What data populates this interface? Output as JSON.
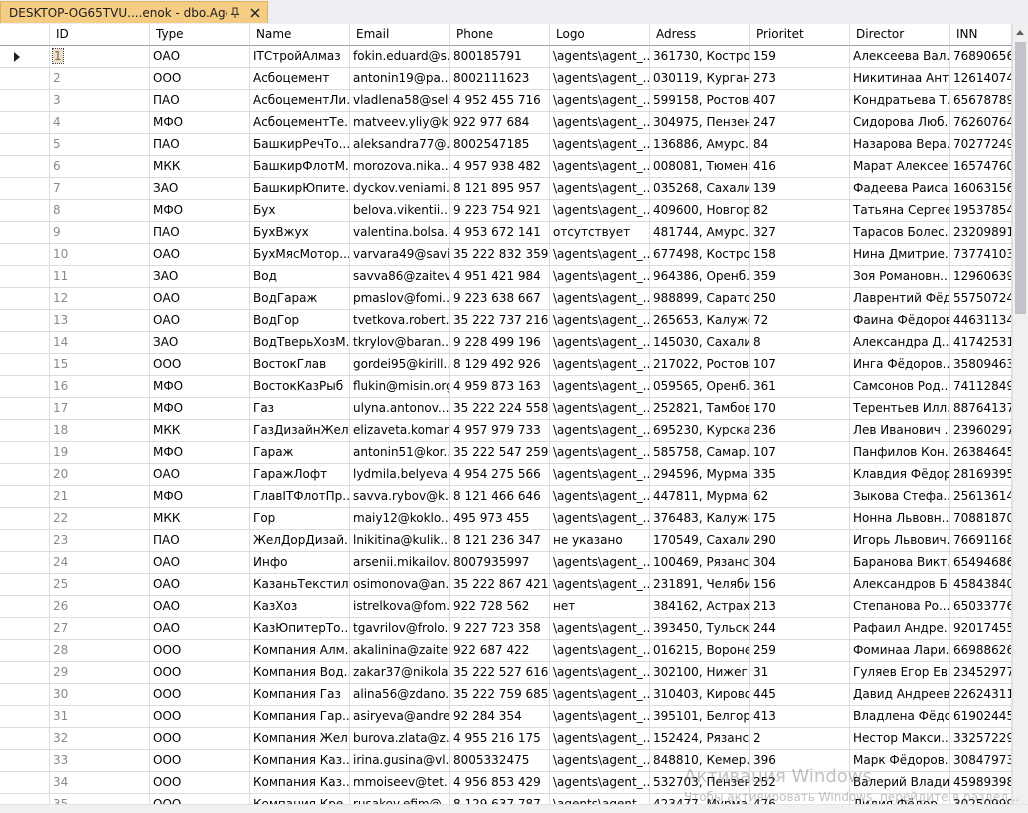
{
  "tab": {
    "title": "DESKTOP-OG65TVU....enok - dbo.Agents"
  },
  "columns": [
    "ID",
    "Type",
    "Name",
    "Email",
    "Phone",
    "Logo",
    "Adress",
    "Prioritet",
    "Director",
    "INN"
  ],
  "rows": [
    [
      "1",
      "ОАО",
      "ITСтройАлмаз",
      "fokin.eduard@s...",
      "800185791",
      "\\agents\\agent_...",
      "361730, Костро...",
      "159",
      "Алексеева Вал...",
      "7689065648"
    ],
    [
      "2",
      "ООО",
      "Асбоцемент",
      "antonin19@pa...",
      "8002111623",
      "\\agents\\agent_...",
      "030119, Курган...",
      "273",
      "Никитинаа Ант...",
      "1261407459"
    ],
    [
      "3",
      "ПАО",
      "АсбоцементЛи...",
      "vladlena58@sel...",
      "4 952 455 716",
      "\\agents\\agent_...",
      "599158, Ростов...",
      "407",
      "Кондратьева Т...",
      "6567878928"
    ],
    [
      "4",
      "МФО",
      "АсбоцементТе...",
      "matveev.yliy@k...",
      "922 977 684",
      "\\agents\\agent_...",
      "304975, Пензен...",
      "247",
      "Сидорова Люб...",
      "7626076463"
    ],
    [
      "5",
      "ПАО",
      "БашкирРечТо...",
      "aleksandra77@...",
      "8002547185",
      "\\agents\\agent_...",
      "136886, Амурс...",
      "84",
      "Назарова Вера...",
      "7027724917"
    ],
    [
      "6",
      "МКК",
      "БашкирФлотМ...",
      "morozova.nika...",
      "4 957 938 482",
      "\\agents\\agent_...",
      "008081, Тюмен...",
      "416",
      "Марат Алексее...",
      "1657476072"
    ],
    [
      "7",
      "ЗАО",
      "БашкирЮпите...",
      "dyckov.veniami...",
      "8 121 895 957",
      "\\agents\\agent_...",
      "035268, Сахали...",
      "139",
      "Фадеева Раиса ...",
      "1606315697"
    ],
    [
      "8",
      "МФО",
      "Бух",
      "belova.vikentii...",
      "9 223 754 921",
      "\\agents\\agent_...",
      "409600, Новгор...",
      "82",
      "Татьяна Сергее...",
      "1953785418"
    ],
    [
      "9",
      "ПАО",
      "БухВжух",
      "valentina.bolsa...",
      "4 953 672 141",
      "отсутствует",
      "481744, Амурс...",
      "327",
      "Тарасов Болес...",
      "2320989197"
    ],
    [
      "10",
      "ОАО",
      "БухМясМотор...",
      "varvara49@savi...",
      "35 222 832 359",
      "\\agents\\agent_...",
      "677498, Костро...",
      "158",
      "Нина Дмитрие...",
      "7377410338"
    ],
    [
      "11",
      "ЗАО",
      "Вод",
      "savva86@zaitev...",
      "4 951 421 984",
      "\\agents\\agent_...",
      "964386, Оренб...",
      "359",
      "Зоя Романовн...",
      "1296063939"
    ],
    [
      "12",
      "ОАО",
      "ВодГараж",
      "pmaslov@fomi...",
      "9 223 638 667",
      "\\agents\\agent_...",
      "988899, Сарато...",
      "250",
      "Лаврентий Фёд...",
      "5575072431"
    ],
    [
      "13",
      "ОАО",
      "ВодГор",
      "tvetkova.robert...",
      "35 222 737 216",
      "\\agents\\agent_...",
      "265653, Калужс...",
      "72",
      "Фаина Фёдоров...",
      "4463113470"
    ],
    [
      "14",
      "ЗАО",
      "ВодТверьХозМ...",
      "tkrylov@baran...",
      "9 228 499 196",
      "\\agents\\agent_...",
      "145030, Сахали...",
      "8",
      "Александра Д...",
      "4174253174"
    ],
    [
      "15",
      "ООО",
      "ВостокГлав",
      "gordei95@kirill...",
      "8 129 492 926",
      "\\agents\\agent_...",
      "217022, Ростов...",
      "107",
      "Инга Фёдоров...",
      "3580946305"
    ],
    [
      "16",
      "МФО",
      "ВостокКазРыб",
      "flukin@misin.org",
      "4 959 873 163",
      "\\agents\\agent_...",
      "059565, Оренб...",
      "361",
      "Самсонов Род...",
      "7411284960"
    ],
    [
      "17",
      "МФО",
      "Газ",
      "ulyna.antonov...",
      "35 222 224 558",
      "\\agents\\agent_...",
      "252821, Тамбов...",
      "170",
      "Терентьев Илл...",
      "8876413796"
    ],
    [
      "18",
      "МКК",
      "ГазДизайнЖел...",
      "elizaveta.komar...",
      "4 957 979 733",
      "\\agents\\agent_...",
      "695230, Курска...",
      "236",
      "Лев Иванович ...",
      "2396029740"
    ],
    [
      "19",
      "МФО",
      "Гараж",
      "antonin51@kor...",
      "35 222 547 259",
      "\\agents\\agent_...",
      "585758, Самар...",
      "107",
      "Панфилов Кон...",
      "2638464552"
    ],
    [
      "20",
      "ОАО",
      "ГаражЛофт",
      "lydmila.belyeva...",
      "4 954 275 566",
      "\\agents\\agent_...",
      "294596, Мурма...",
      "335",
      "Клавдия Фёдор...",
      "2816939574"
    ],
    [
      "21",
      "МФО",
      "ГлавITФлотПр...",
      "savva.rybov@k...",
      "8 121 466 646",
      "\\agents\\agent_...",
      "447811, Мурма...",
      "62",
      "Зыкова Стефа...",
      "2561361494"
    ],
    [
      "22",
      "МКК",
      "Гор",
      "maiy12@koklo...",
      "495 973 455",
      "\\agents\\agent_...",
      "376483, Калужс...",
      "175",
      "Нонна Львовн...",
      "7088187045"
    ],
    [
      "23",
      "ПАО",
      "ЖелДорДизай...",
      "lnikitina@kulik...",
      "8 121 236 347",
      "не указано",
      "170549, Сахали...",
      "290",
      "Игорь Львович...",
      "7669116841"
    ],
    [
      "24",
      "ОАО",
      "Инфо",
      "arsenii.mikailov...",
      "8007935997",
      "\\agents\\agent_...",
      "100469, Рязанс...",
      "304",
      "Баранова Викт...",
      "6549468639"
    ],
    [
      "25",
      "ОАО",
      "КазаньТекстиль",
      "osimonova@an...",
      "35 222 867 421",
      "\\agents\\agent_...",
      "231891, Челяби...",
      "156",
      "Александров Б...",
      "4584384019"
    ],
    [
      "26",
      "ОАО",
      "КазХоз",
      "istrelkova@fom...",
      "922 728 562",
      "нет",
      "384162, Астрах...",
      "213",
      "Степанова Ро...",
      "6503377671"
    ],
    [
      "27",
      "ОАО",
      "КазЮпитерТо...",
      "tgavrilov@frolo...",
      "9 227 723 358",
      "\\agents\\agent_...",
      "393450, Тульск...",
      "244",
      "Рафаил Андре...",
      "9201745524"
    ],
    [
      "28",
      "ООО",
      "Компания Алм...",
      "akalinina@zaite...",
      "922 687 422",
      "\\agents\\agent_...",
      "016215, Вороне...",
      "259",
      "Фоминаа Лари...",
      "6698862694"
    ],
    [
      "29",
      "ООО",
      "Компания Вод...",
      "zakar37@nikola...",
      "35 222 527 616",
      "\\agents\\agent_...",
      "302100, Нижег...",
      "31",
      "Гуляев Егор Ев...",
      "2345297765"
    ],
    [
      "30",
      "ООО",
      "Компания Газ",
      "alina56@zdano...",
      "35 222 759 685",
      "\\agents\\agent_...",
      "310403, Кировс...",
      "445",
      "Давид Андреев...",
      "2262431140"
    ],
    [
      "31",
      "ООО",
      "Компания Гар...",
      "asiryeva@andre...",
      "92 284 354",
      "\\agents\\agent_...",
      "395101, Белгор...",
      "413",
      "Владлена Фёдо...",
      "6190244524"
    ],
    [
      "32",
      "ООО",
      "Компания Жел...",
      "burova.zlata@z...",
      "4 955 216 175",
      "\\agents\\agent_...",
      "152424, Рязанс...",
      "2",
      "Нестор Макси...",
      "3325722996"
    ],
    [
      "33",
      "ООО",
      "Компания Каз...",
      "irina.gusina@vl...",
      "8005332475",
      "\\agents\\agent_...",
      "848810, Кемер...",
      "396",
      "Марк Фёдоров...",
      "3084797352"
    ],
    [
      "34",
      "ООО",
      "Компания Каз...",
      "mmoiseev@tet...",
      "4 956 853 429",
      "\\agents\\agent_...",
      "532703, Пензен...",
      "252",
      "Валерий Влади...",
      "4598939812"
    ],
    [
      "35",
      "ООО",
      "Компания Кре...",
      "rusakov.efim@...",
      "8 129 637 787",
      "\\agents\\agent_...",
      "423477, Мурма...",
      "476",
      "Лидия Фёдор...",
      "3025099903"
    ]
  ],
  "watermark": {
    "title": "Активация Windows",
    "sub": "Чтобы активировать Windows, перейдите в раздел..."
  }
}
